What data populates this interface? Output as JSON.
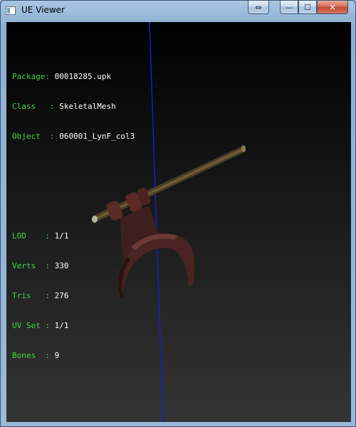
{
  "window": {
    "title": "UE Viewer"
  },
  "titlebar_buttons": {
    "resize": "⇔",
    "minimize": "—",
    "maximize": "☐",
    "close": "✕"
  },
  "info_top": [
    {
      "label": "Package: ",
      "value": "00018285.upk"
    },
    {
      "label": "Class   : ",
      "value": "SkeletalMesh"
    },
    {
      "label": "Object  : ",
      "value": "060001_LynF_col3"
    }
  ],
  "info_stats": [
    {
      "label": "LOD    : ",
      "value": "1/1"
    },
    {
      "label": "Verts  : ",
      "value": "330"
    },
    {
      "label": "Tris   : ",
      "value": "276"
    },
    {
      "label": "UV Set : ",
      "value": "1/1"
    },
    {
      "label": "Bones  : ",
      "value": "9"
    }
  ],
  "colors": {
    "label": "#3fd83f",
    "value": "#ffffff",
    "axis": "#1a1ad0"
  }
}
